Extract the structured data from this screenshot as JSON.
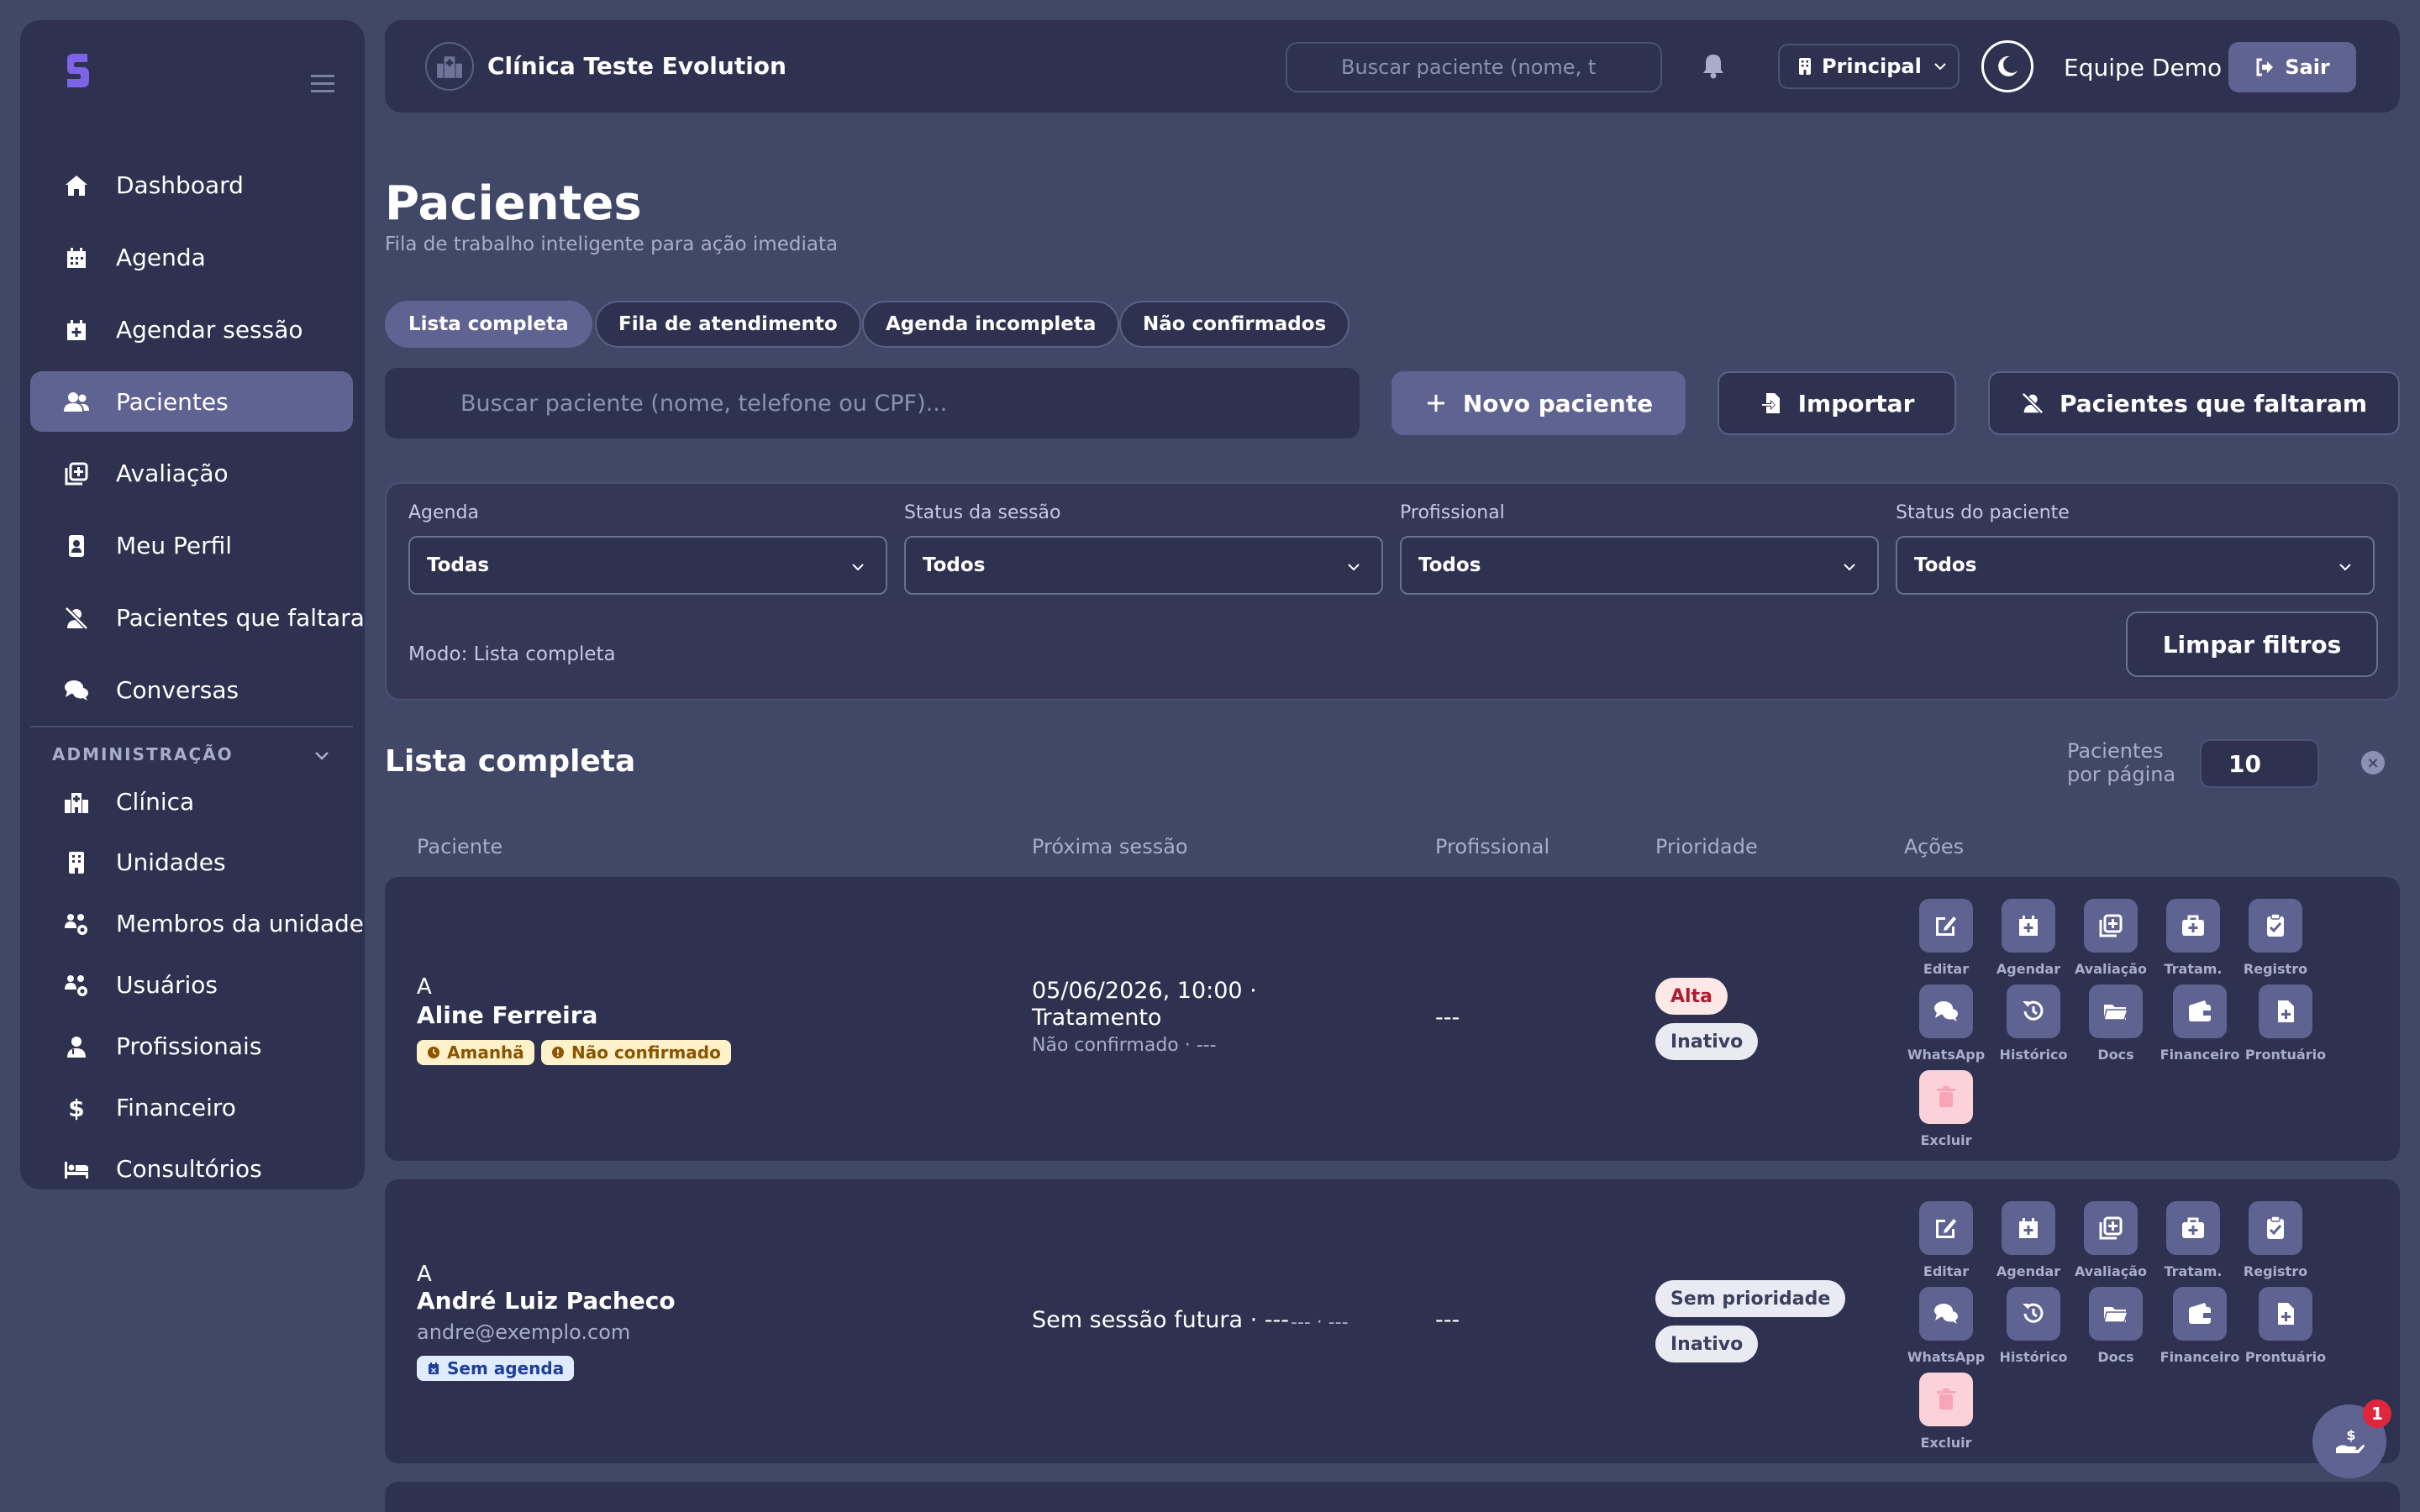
{
  "app": {
    "clinic_name": "Clínica Teste Evolution",
    "header_search_placeholder": "Buscar paciente (nome, t",
    "unit": "Principal",
    "user": "Equipe Demo",
    "logout": "Sair",
    "brand_color": "#5f6391"
  },
  "sidebar": {
    "items": [
      {
        "label": "Dashboard",
        "icon": "home-icon"
      },
      {
        "label": "Agenda",
        "icon": "calendar-icon"
      },
      {
        "label": "Agendar sessão",
        "icon": "calendar-plus-icon"
      },
      {
        "label": "Pacientes",
        "icon": "users-icon",
        "active": true
      },
      {
        "label": "Avaliação",
        "icon": "clipboard-plus-icon"
      },
      {
        "label": "Meu Perfil",
        "icon": "id-badge-icon"
      },
      {
        "label": "Pacientes que faltaram",
        "icon": "user-slash-icon"
      },
      {
        "label": "Conversas",
        "icon": "comments-icon"
      }
    ],
    "admin_label": "ADMINISTRAÇÃO",
    "admin_items": [
      {
        "label": "Clínica",
        "icon": "hospital-icon"
      },
      {
        "label": "Unidades",
        "icon": "building-icon"
      },
      {
        "label": "Membros da unidade",
        "icon": "users-cog-icon"
      },
      {
        "label": "Usuários",
        "icon": "users-gear-icon"
      },
      {
        "label": "Profissionais",
        "icon": "user-doctor-icon"
      },
      {
        "label": "Financeiro",
        "icon": "dollar-icon"
      },
      {
        "label": "Consultórios",
        "icon": "bed-icon"
      }
    ]
  },
  "page": {
    "title": "Pacientes",
    "subtitle": "Fila de trabalho inteligente para ação imediata",
    "tabs": [
      "Lista completa",
      "Fila de atendimento",
      "Agenda incompleta",
      "Não confirmados"
    ],
    "search_placeholder": "Buscar paciente (nome, telefone ou CPF)...",
    "new_patient": "Novo paciente",
    "import": "Importar",
    "missed": "Pacientes que faltaram"
  },
  "filters": {
    "agenda_label": "Agenda",
    "agenda_value": "Todas",
    "session_label": "Status da sessão",
    "session_value": "Todos",
    "professional_label": "Profissional",
    "professional_value": "Todos",
    "patient_label": "Status do paciente",
    "patient_value": "Todos",
    "mode": "Modo: Lista completa",
    "clear": "Limpar filtros"
  },
  "list": {
    "title": "Lista completa",
    "per_page_label": "Pacientes por página",
    "per_page": "10",
    "columns": [
      "Paciente",
      "Próxima sessão",
      "Profissional",
      "Prioridade",
      "Ações"
    ],
    "actions": [
      "Editar",
      "Agendar",
      "Avaliação",
      "Tratam.",
      "Registro",
      "WhatsApp",
      "Histórico",
      "Docs",
      "Financeiro",
      "Prontuário",
      "Excluir"
    ],
    "rows": [
      {
        "initial": "A",
        "name": "Aline Ferreira",
        "tags": [
          "Amanhã",
          "Não confirmado"
        ],
        "session_line1": "05/06/2026, 10:00 ·",
        "session_line2": "Tratamento",
        "session_sub": "Não confirmado · ---",
        "professional": "---",
        "priority": "Alta",
        "status": "Inativo"
      },
      {
        "initial": "A",
        "name": "André Luiz Pacheco",
        "email": "andre@exemplo.com",
        "tags": [
          "Sem agenda"
        ],
        "session_line1": "Sem sessão futura · ---",
        "session_sub": "--- · ---",
        "professional": "---",
        "priority": "Sem prioridade",
        "status": "Inativo"
      }
    ]
  },
  "floating": {
    "badge": "1"
  }
}
